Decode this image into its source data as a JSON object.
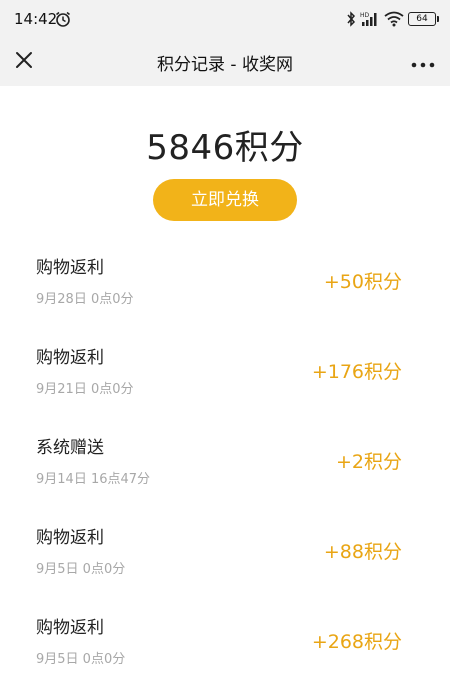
{
  "status_bar": {
    "time": "14:42",
    "battery": "64",
    "icons": [
      "alarm-icon",
      "bluetooth-icon",
      "hd-signal-icon",
      "wifi-icon",
      "battery-icon"
    ]
  },
  "title_bar": {
    "title": "积分记录 - 收奖网",
    "close_icon": "close-icon",
    "more_icon": "more-icon"
  },
  "summary": {
    "points_total": "5846积分",
    "redeem_label": "立即兑换"
  },
  "colors": {
    "accent": "#f2b319",
    "amount": "#e9a514",
    "bar_bg": "#f2f2f2"
  },
  "records": [
    {
      "title": "购物返利",
      "date": "9月28日  0点0分",
      "amount": "+50积分"
    },
    {
      "title": "购物返利",
      "date": "9月21日  0点0分",
      "amount": "+176积分"
    },
    {
      "title": "系统赠送",
      "date": "9月14日  16点47分",
      "amount": "+2积分"
    },
    {
      "title": "购物返利",
      "date": "9月5日  0点0分",
      "amount": "+88积分"
    },
    {
      "title": "购物返利",
      "date": "9月5日  0点0分",
      "amount": "+268积分"
    }
  ]
}
